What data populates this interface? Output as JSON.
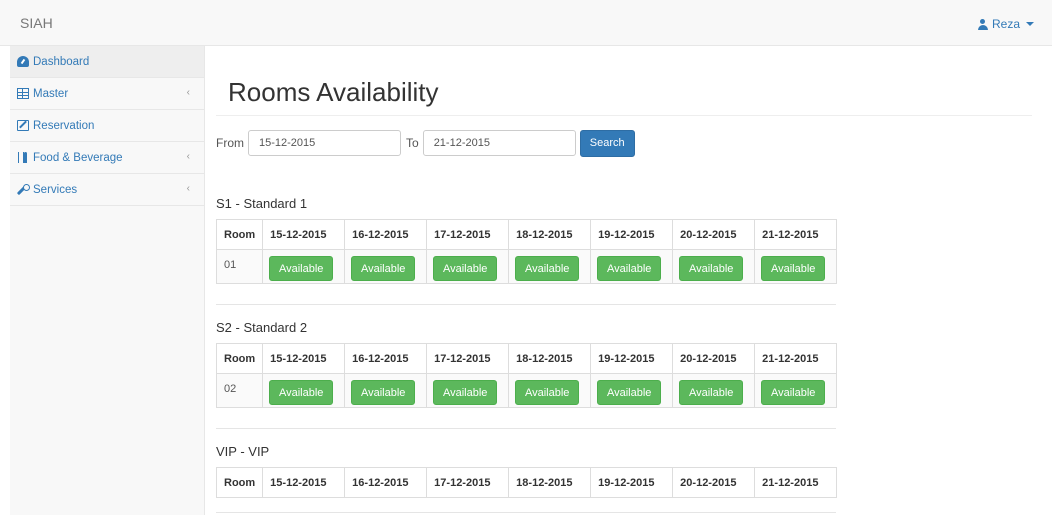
{
  "navbar": {
    "brand": "SIAH",
    "user": "Reza",
    "user_icon": "user-icon"
  },
  "sidebar": {
    "items": [
      {
        "label": "Dashboard",
        "icon": "dashboard-icon",
        "active": true,
        "has_submenu": false
      },
      {
        "label": "Master",
        "icon": "table-icon",
        "active": false,
        "has_submenu": true
      },
      {
        "label": "Reservation",
        "icon": "edit-icon",
        "active": false,
        "has_submenu": false
      },
      {
        "label": "Food & Beverage",
        "icon": "cutlery-icon",
        "active": false,
        "has_submenu": true
      },
      {
        "label": "Services",
        "icon": "wrench-icon",
        "active": false,
        "has_submenu": true
      }
    ],
    "chevron": "‹"
  },
  "page": {
    "title": "Rooms Availability"
  },
  "filter": {
    "from_label": "From",
    "from_value": "15-12-2015",
    "to_label": "To",
    "to_value": "21-12-2015",
    "search_label": "Search"
  },
  "table_header": {
    "room": "Room",
    "dates": [
      "15-12-2015",
      "16-12-2015",
      "17-12-2015",
      "18-12-2015",
      "19-12-2015",
      "20-12-2015",
      "21-12-2015"
    ]
  },
  "sections": [
    {
      "title": "S1 - Standard 1",
      "rooms": [
        {
          "number": "01",
          "status": [
            "Available",
            "Available",
            "Available",
            "Available",
            "Available",
            "Available",
            "Available"
          ]
        }
      ]
    },
    {
      "title": "S2 - Standard 2",
      "rooms": [
        {
          "number": "02",
          "status": [
            "Available",
            "Available",
            "Available",
            "Available",
            "Available",
            "Available",
            "Available"
          ]
        }
      ]
    },
    {
      "title": "VIP - VIP",
      "rooms": []
    }
  ],
  "colors": {
    "primary": "#337ab7",
    "available": "#5cb85c",
    "navbar_bg": "#f8f8f8"
  }
}
